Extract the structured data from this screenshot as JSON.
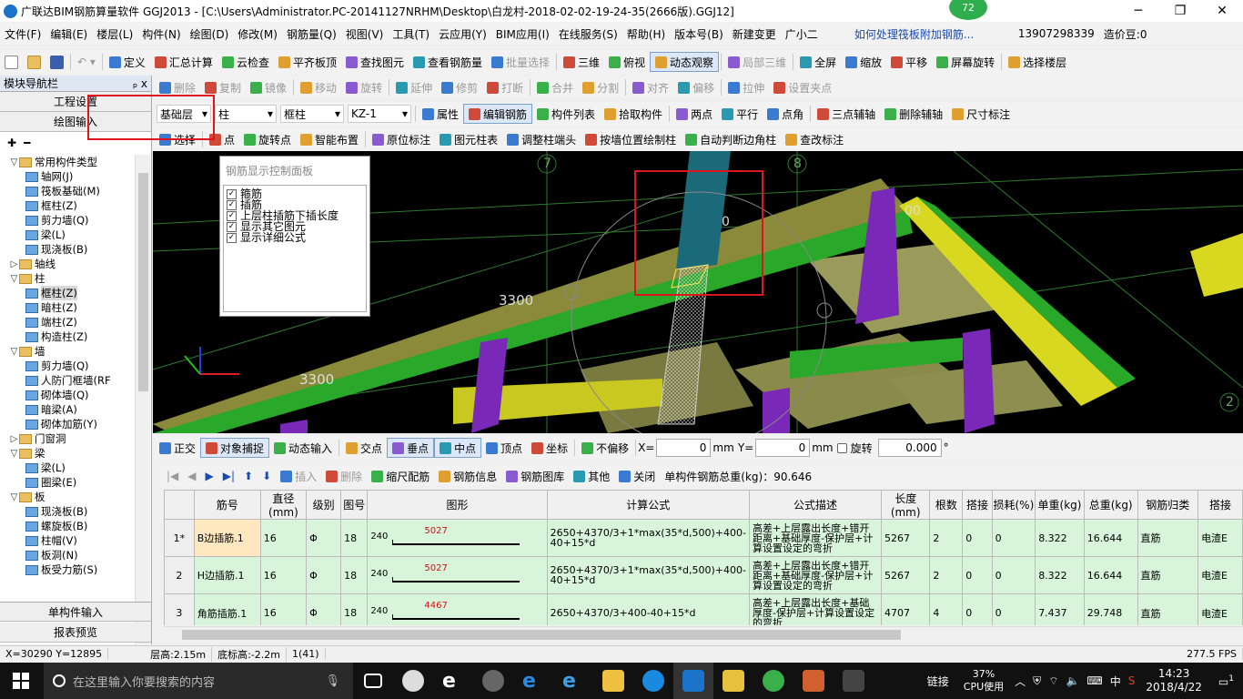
{
  "app": {
    "title": "广联达BIM钢筋算量软件 GGJ2013 - [C:\\Users\\Administrator.PC-20141127NRHM\\Desktop\\白龙村-2018-02-02-19-24-35(2666版).GGJ12]",
    "badge": "72"
  },
  "menu": [
    "文件(F)",
    "编辑(E)",
    "楼层(L)",
    "构件(N)",
    "绘图(D)",
    "修改(M)",
    "钢筋量(Q)",
    "视图(V)",
    "工具(T)",
    "云应用(Y)",
    "BIM应用(I)",
    "在线服务(S)",
    "帮助(H)",
    "版本号(B)",
    "新建变更",
    "广小二",
    "如何处理筏板附加钢筋...",
    "13907298339",
    "造价豆:0"
  ],
  "toolbar1": [
    "定义",
    "汇总计算",
    "云检查",
    "平齐板顶",
    "查找图元",
    "查看钢筋量",
    "批量选择",
    "三维",
    "俯视",
    "动态观察",
    "局部三维",
    "全屏",
    "缩放",
    "平移",
    "屏幕旋转",
    "选择楼层"
  ],
  "toolbar2": [
    "删除",
    "复制",
    "镜像",
    "移动",
    "旋转",
    "延伸",
    "修剪",
    "打断",
    "合并",
    "分割",
    "对齐",
    "偏移",
    "拉伸",
    "设置夹点"
  ],
  "toolbar3": {
    "floor": "基础层",
    "category": "柱",
    "type": "框柱",
    "name": "KZ-1",
    "items": [
      "属性",
      "编辑钢筋",
      "构件列表",
      "拾取构件",
      "两点",
      "平行",
      "点角",
      "三点辅轴",
      "删除辅轴",
      "尺寸标注"
    ]
  },
  "toolbar4": [
    "选择",
    "点",
    "旋转点",
    "智能布置",
    "原位标注",
    "图元柱表",
    "调整柱端头",
    "按墙位置绘制柱",
    "自动判断边角柱",
    "查改标注"
  ],
  "nav": {
    "title": "模块导航栏",
    "pin": "ₚ x",
    "top_buttons": [
      "工程设置",
      "绘图输入"
    ],
    "bottom_buttons": [
      "单构件输入",
      "报表预览"
    ],
    "tree": [
      {
        "label": "常用构件类型",
        "level": 0,
        "folder": true,
        "exp": "▽"
      },
      {
        "label": "轴网(J)",
        "level": 1
      },
      {
        "label": "筏板基础(M)",
        "level": 1
      },
      {
        "label": "框柱(Z)",
        "level": 1
      },
      {
        "label": "剪力墙(Q)",
        "level": 1
      },
      {
        "label": "梁(L)",
        "level": 1
      },
      {
        "label": "现浇板(B)",
        "level": 1
      },
      {
        "label": "轴线",
        "level": 0,
        "folder": true,
        "exp": "▷"
      },
      {
        "label": "柱",
        "level": 0,
        "folder": true,
        "exp": "▽"
      },
      {
        "label": "框柱(Z)",
        "level": 1
      },
      {
        "label": "暗柱(Z)",
        "level": 1
      },
      {
        "label": "端柱(Z)",
        "level": 1
      },
      {
        "label": "构造柱(Z)",
        "level": 1
      },
      {
        "label": "墙",
        "level": 0,
        "folder": true,
        "exp": "▽"
      },
      {
        "label": "剪力墙(Q)",
        "level": 1
      },
      {
        "label": "人防门框墙(RF",
        "level": 1
      },
      {
        "label": "砌体墙(Q)",
        "level": 1
      },
      {
        "label": "暗梁(A)",
        "level": 1
      },
      {
        "label": "砌体加筋(Y)",
        "level": 1
      },
      {
        "label": "门窗洞",
        "level": 0,
        "folder": true,
        "exp": "▷"
      },
      {
        "label": "梁",
        "level": 0,
        "folder": true,
        "exp": "▽"
      },
      {
        "label": "梁(L)",
        "level": 1
      },
      {
        "label": "圈梁(E)",
        "level": 1
      },
      {
        "label": "板",
        "level": 0,
        "folder": true,
        "exp": "▽"
      },
      {
        "label": "现浇板(B)",
        "level": 1
      },
      {
        "label": "螺旋板(B)",
        "level": 1
      },
      {
        "label": "柱帽(V)",
        "level": 1
      },
      {
        "label": "板洞(N)",
        "level": 1
      },
      {
        "label": "板受力筋(S)",
        "level": 1
      }
    ]
  },
  "viewport": {
    "panel_title": "钢筋显示控制面板",
    "checks": [
      "箍筋",
      "插筋",
      "上层柱插筋下插长度",
      "显示其它图元",
      "显示详细公式"
    ],
    "labels": {
      "a": "3300",
      "b": "3300",
      "c": "7",
      "d": "8",
      "e": "2",
      "f": "0",
      "g": "00"
    }
  },
  "snap": {
    "items": [
      "正交",
      "对象捕捉",
      "动态输入",
      "交点",
      "垂点",
      "中点",
      "顶点",
      "坐标",
      "不偏移"
    ],
    "x_label": "X=",
    "x": "0",
    "y_label": "Y=",
    "y": "0",
    "unit": "mm",
    "rotate": "旋转",
    "rot": "0.000",
    "deg": "°"
  },
  "rebar_toolbar": {
    "items": [
      "插入",
      "删除",
      "缩尺配筋",
      "钢筋信息",
      "钢筋图库",
      "其他",
      "关闭"
    ],
    "total": "单构件钢筋总重(kg)：90.646"
  },
  "grid": {
    "headers": [
      "筋号",
      "直径(mm)",
      "级别",
      "图号",
      "图形",
      "计算公式",
      "公式描述",
      "长度(mm)",
      "根数",
      "搭接",
      "损耗(%)",
      "单重(kg)",
      "总重(kg)",
      "钢筋归类",
      "搭接"
    ],
    "rows": [
      {
        "rh": "1*",
        "name": "B边插筋.1",
        "dia": "16",
        "grade": "Φ",
        "fig": "18",
        "pre": "240",
        "len_label": "5027",
        "formula": "2650+4370/3+1*max(35*d,500)+400-40+15*d",
        "desc": "高差+上层露出长度+错开距离+基础厚度-保护层+计算设置设定的弯折",
        "length": "5267",
        "count": "2",
        "lap": "0",
        "loss": "0",
        "unit_w": "8.322",
        "total_w": "16.644",
        "cls": "直筋",
        "lap2": "电渣E"
      },
      {
        "rh": "2",
        "name": "H边插筋.1",
        "dia": "16",
        "grade": "Φ",
        "fig": "18",
        "pre": "240",
        "len_label": "5027",
        "formula": "2650+4370/3+1*max(35*d,500)+400-40+15*d",
        "desc": "高差+上层露出长度+错开距离+基础厚度-保护层+计算设置设定的弯折",
        "length": "5267",
        "count": "2",
        "lap": "0",
        "loss": "0",
        "unit_w": "8.322",
        "total_w": "16.644",
        "cls": "直筋",
        "lap2": "电渣E"
      },
      {
        "rh": "3",
        "name": "角筋插筋.1",
        "dia": "16",
        "grade": "Φ",
        "fig": "18",
        "pre": "240",
        "len_label": "4467",
        "formula": "2650+4370/3+400-40+15*d",
        "desc": "高差+上层露出长度+基础厚度-保护层+计算设置设定的弯折",
        "length": "4707",
        "count": "4",
        "lap": "0",
        "loss": "0",
        "unit_w": "7.437",
        "total_w": "29.748",
        "cls": "直筋",
        "lap2": "电渣E"
      }
    ]
  },
  "status": [
    "X=30290 Y=12895",
    "层高:2.15m",
    "底标高:-2.2m",
    "1(41)",
    "277.5 FPS"
  ],
  "taskbar": {
    "search": "在这里输入你要搜索的内容",
    "link": "链接",
    "cpu": "37%",
    "cpu_label": "CPU使用",
    "ime": "中",
    "time": "14:23",
    "date": "2018/4/22",
    "notif": "1"
  }
}
